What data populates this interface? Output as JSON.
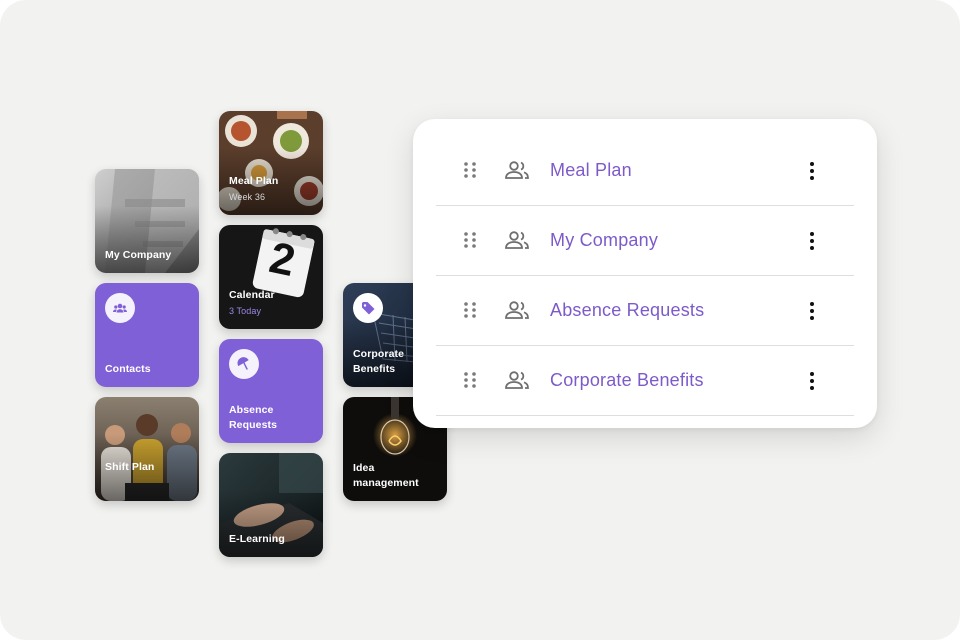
{
  "tiles": {
    "my_company": {
      "label": "My Company"
    },
    "contacts": {
      "label": "Contacts"
    },
    "shift_plan": {
      "label": "Shift Plan"
    },
    "meal_plan": {
      "label": "Meal Plan",
      "sub": "Week 36"
    },
    "calendar": {
      "label": "Calendar",
      "sub": "3 Today",
      "date_digit": "2"
    },
    "absence": {
      "label_line1": "Absence",
      "label_line2": "Requests"
    },
    "elearning": {
      "label": "E-Learning"
    },
    "corporate": {
      "label_line1": "Corporate",
      "label_line2": "Benefits"
    },
    "idea": {
      "label_line1": "Idea",
      "label_line2": "management"
    }
  },
  "list": {
    "items": [
      {
        "name": "Meal Plan",
        "icon": "people-icon"
      },
      {
        "name": "My Company",
        "icon": "people-icon"
      },
      {
        "name": "Absence Requests",
        "icon": "people-icon"
      },
      {
        "name": "Corporate Benefits",
        "icon": "people-icon"
      }
    ]
  },
  "colors": {
    "accent": "#8060d6",
    "list_text": "#7d5ac9",
    "background": "#f2f2f0"
  }
}
